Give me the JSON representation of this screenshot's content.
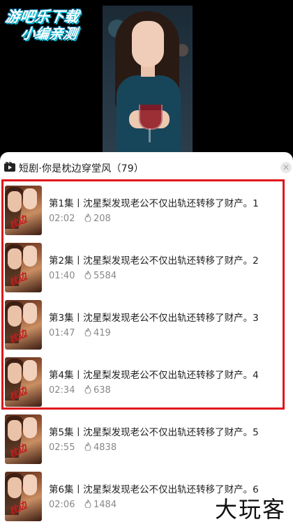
{
  "video": {
    "logo_line1": "游吧乐下载",
    "logo_line2": "小编亲测"
  },
  "sheet": {
    "title": "短剧·你是枕边穿堂风（79）",
    "close_icon": "close-icon"
  },
  "episodes": [
    {
      "title": "第1集丨沈星梨发现老公不仅出轨还转移了财产。1",
      "duration": "02:02",
      "plays": "208"
    },
    {
      "title": "第2集丨沈星梨发现老公不仅出轨还转移了财产。2",
      "duration": "01:40",
      "plays": "5584"
    },
    {
      "title": "第3集丨沈星梨发现老公不仅出轨还转移了财产。3",
      "duration": "01:47",
      "plays": "419"
    },
    {
      "title": "第4集丨沈星梨发现老公不仅出轨还转移了财产。4",
      "duration": "02:34",
      "plays": "638"
    },
    {
      "title": "第5集丨沈星梨发现老公不仅出轨还转移了财产。5",
      "duration": "02:55",
      "plays": "4838"
    },
    {
      "title": "第6集丨沈星梨发现老公不仅出轨还转移了财产。6",
      "duration": "02:06",
      "plays": "1484"
    }
  ],
  "watermark": "大玩客",
  "colors": {
    "highlight": "#e0141a",
    "logo_accent": "#0cc0d8"
  }
}
